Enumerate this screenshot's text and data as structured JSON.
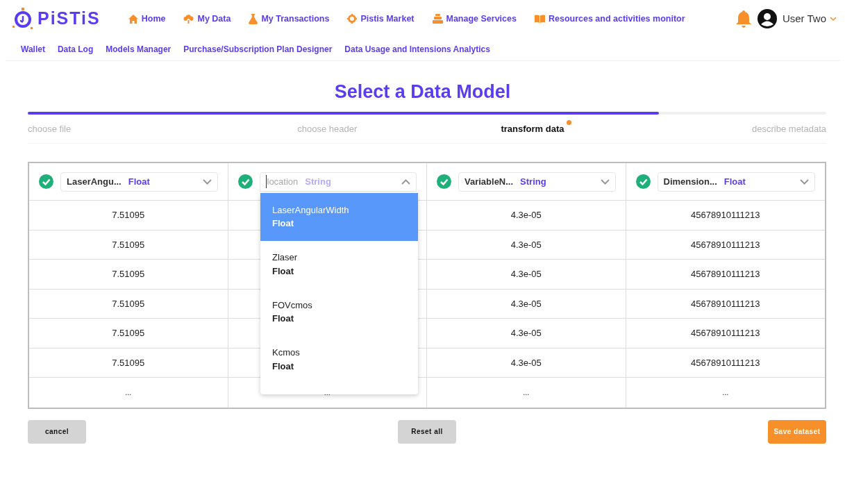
{
  "brand": "PiSTiS",
  "nav": [
    {
      "label": "Home"
    },
    {
      "label": "My Data"
    },
    {
      "label": "My Transactions"
    },
    {
      "label": "Pistis Market"
    },
    {
      "label": "Manage Services"
    },
    {
      "label": "Resources and activities monitor"
    }
  ],
  "user": {
    "name": "User Two"
  },
  "subnav": [
    "Wallet",
    "Data Log",
    "Models Manager",
    "Purchase/Subscription Plan Designer",
    "Data Usage and Intensions Analytics"
  ],
  "title": "Select a Data Model",
  "progress": {
    "level": 0.79
  },
  "steps": [
    {
      "label": "choose file",
      "selected": false
    },
    {
      "label": "choose header",
      "selected": false
    },
    {
      "label": "transform data",
      "selected": true
    },
    {
      "label": "describe metadata",
      "selected": false
    }
  ],
  "columns": [
    {
      "name": "LaserAngu...",
      "type": "Float",
      "valid": true,
      "expanded": false
    },
    {
      "name": "location",
      "type": "String",
      "valid": true,
      "expanded": true
    },
    {
      "name": "VariableN...",
      "type": "String",
      "valid": true,
      "expanded": false
    },
    {
      "name": "Dimension...",
      "type": "Float",
      "valid": true,
      "expanded": false
    }
  ],
  "rows": [
    [
      "7.51095",
      null,
      "4.3e-05",
      "45678910111213"
    ],
    [
      "7.51095",
      null,
      "4.3e-05",
      "45678910111213"
    ],
    [
      "7.51095",
      null,
      "4.3e-05",
      "45678910111213"
    ],
    [
      "7.51095",
      null,
      "4.3e-05",
      "45678910111213"
    ],
    [
      "7.51095",
      null,
      "4.3e-05",
      "45678910111213"
    ],
    [
      "7.51095",
      null,
      "4.3e-05",
      "45678910111213"
    ],
    [
      "...",
      "...",
      "...",
      "..."
    ]
  ],
  "dropdown": [
    {
      "name": "LaserAngularWidth",
      "type": "Float",
      "selected": true
    },
    {
      "name": "Zlaser",
      "type": "Float",
      "selected": false
    },
    {
      "name": "FOVcmos",
      "type": "Float",
      "selected": false
    },
    {
      "name": "Kcmos",
      "type": "Float",
      "selected": false
    }
  ],
  "buttons": [
    {
      "label": "cancel",
      "kind": "secondary"
    },
    {
      "label": "Reset all",
      "kind": "secondary"
    },
    {
      "label": "Save dataset",
      "kind": "primary"
    }
  ]
}
